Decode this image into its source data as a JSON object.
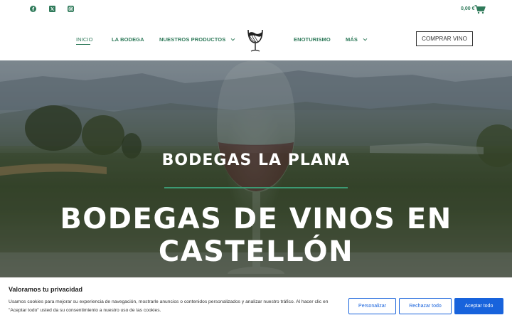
{
  "topbar": {
    "socials": [
      {
        "icon": "facebook-icon"
      },
      {
        "icon": "x-twitter-icon"
      },
      {
        "icon": "instagram-icon"
      }
    ],
    "cart_amount": "0,00 €",
    "cart_icon": "shopping-cart-icon"
  },
  "nav": {
    "items": [
      {
        "label": "INICIO",
        "active": true,
        "dropdown": false
      },
      {
        "label": "LA BODEGA",
        "active": false,
        "dropdown": false
      },
      {
        "label": "NUESTROS PRODUCTOS",
        "active": false,
        "dropdown": true
      },
      {
        "label": "ENOTURISMO",
        "active": false,
        "dropdown": false
      },
      {
        "label": "MÁS",
        "active": false,
        "dropdown": true
      }
    ],
    "logo_icon": "bodega-logo-icon",
    "buy_button": "COMPRAR VINO"
  },
  "hero": {
    "subtitle": "BODEGAS LA PLANA",
    "title": "BODEGAS DE VINOS EN CASTELLÓN"
  },
  "cookie": {
    "title": "Valoramos tu privacidad",
    "text": "Usamos cookies para mejorar su experiencia de navegación, mostrarle anuncios o contenidos personalizados y analizar nuestro tráfico. Al hacer clic en \"Aceptar todo\" usted da su consentimiento a nuestro uso de las cookies.",
    "buttons": {
      "customize": "Personalizar",
      "reject": "Rechazar todo",
      "accept": "Aceptar todo"
    }
  },
  "colors": {
    "brand_green": "#2f7a5a",
    "accent_line": "#3c9a73",
    "cookie_blue": "#1863dc"
  }
}
